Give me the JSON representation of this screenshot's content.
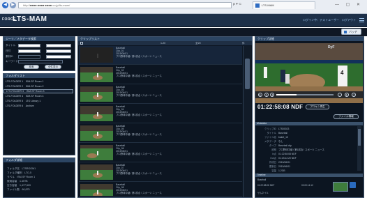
{
  "browser": {
    "address": "http://■■■■.■■■■.■■■■.co.jp/lts-mam/",
    "address_icons": "ρ ▾ ⊂",
    "tab_title": "LTS-MAM",
    "window_buttons": "— ▢ ✕"
  },
  "header": {
    "brand": "FORCE",
    "app_name": "LTS-MAM",
    "user_info": "ログイン中：テストユーザー　ログアウト",
    "batch_button": "バッチ"
  },
  "search_panel": {
    "title": "ジーリ／メタデータ検索",
    "row_labels": [
      "タイトル",
      "日付",
      "素材ID",
      "キーワード"
    ],
    "search_button": "検索",
    "clear_button": "全件表示"
  },
  "folder_panel": {
    "title": "フォルダリスト",
    "items": [
      "LTS-FOLDER 1　ISM-SF Room 1",
      "LTS-FOLDER 2　ISM-SF Room 2",
      "LTS-FOLDER 3　ISM-SF Room 3",
      "LTS-FOLDER 4　ISM-SF Room 4",
      "LTS-FOLDER 5　LTO Library 1",
      "LTS-FOLDER 6　Archive"
    ]
  },
  "folder_props": {
    "title": "フォルダ詳細",
    "rows": [
      "フォルダ名　LTSROOM1",
      "フォルダ種別　LTO-5",
      "ラベル　ISM-SF Room 1",
      "使用容量　1.45TB",
      "空き容量　1,477,509",
      "ファイル数　60,875"
    ]
  },
  "clip_list": {
    "title": "クリップリスト",
    "columns": [
      "",
      "",
      "1-20",
      "全20",
      ""
    ],
    "page_label": "件",
    "clips": [
      {
        "l1": "Baseball",
        "l2": "Clip_01",
        "l3": "2015/06/01",
        "l4": "プロ野球中継 / 第1試合 / スポーツ ニュース"
      },
      {
        "l1": "Baseball",
        "l2": "Clip_02",
        "l3": "2015/06/01",
        "l4": "プロ野球中継 / 第1試合 / スポーツ ニュース"
      },
      {
        "l1": "Baseball",
        "l2": "Clip_03",
        "l3": "2015/06/01",
        "l4": "プロ野球中継 / 第1試合 / スポーツ ニュース"
      },
      {
        "l1": "Baseball",
        "l2": "Clip_04",
        "l3": "2015/06/01",
        "l4": "プロ野球中継 / 第1試合 / スポーツ ニュース"
      },
      {
        "l1": "Baseball",
        "l2": "Clip_05",
        "l3": "2015/06/01",
        "l4": "プロ野球中継 / 第1試合 / スポーツ ニュース"
      },
      {
        "l1": "Baseball",
        "l2": "Clip_06",
        "l3": "2015/06/01",
        "l4": "プロ野球中継 / 第1試合 / スポーツ ニュース"
      },
      {
        "l1": "Baseball",
        "l2": "Clip_07",
        "l3": "2015/06/01",
        "l4": "プロ野球中継 / 第1試合 / スポーツ ニュース"
      },
      {
        "l1": "Baseball",
        "l2": "Clip_08",
        "l3": "2015/06/01",
        "l4": "プロ野球中継 / 第1試合 / スポーツ ニュース"
      }
    ]
  },
  "preview": {
    "title": "クリップ詳細",
    "brand": "DyF",
    "player_number": "4",
    "progress": 0.35,
    "timecode": "01:22:58:08 NDF",
    "metadata_button": "プロキシ再生",
    "extra_button": "ファイル情報",
    "detail_title": "Metadata",
    "details": [
      {
        "k": "クリップID",
        "v": "LTS00023"
      },
      {
        "k": "タイトル",
        "v": "Baseball"
      },
      {
        "k": "ファイル名",
        "v": "baket_13"
      },
      {
        "k": "メタデータ",
        "v": "なし"
      },
      {
        "k": "タイプ",
        "v": "Baseball clip"
      },
      {
        "k": "説明",
        "v": "プロ野球中継 / 第1試合 / スポーツ ニュース"
      },
      {
        "k": "In点",
        "v": "01:22:58:08 NDF"
      },
      {
        "k": "Out点",
        "v": "01:23:12:20 NDF"
      },
      {
        "k": "作成日",
        "v": "2015/06/01"
      },
      {
        "k": "更新日",
        "v": "2015/06/01"
      },
      {
        "k": "容量",
        "v": "1.2GB"
      }
    ],
    "timeline_title": "Timeline",
    "timeline_rows": [
      "Baseball",
      "01:22:58:08 NDF",
      "00:00:14:12",
      "サムネイル"
    ]
  }
}
